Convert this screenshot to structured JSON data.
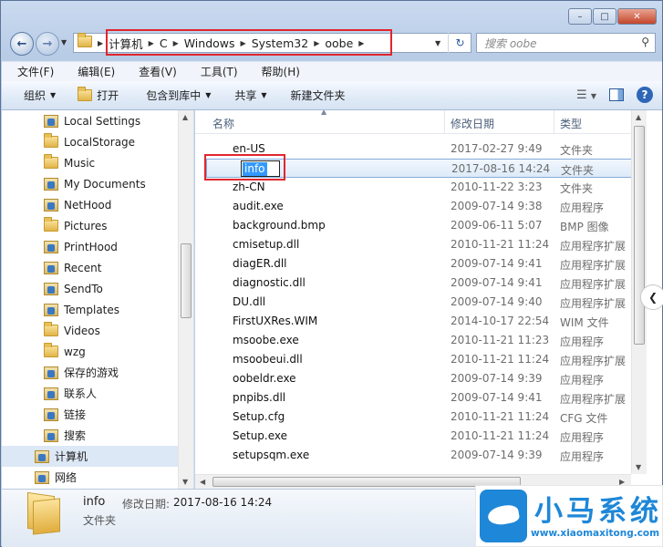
{
  "address": {
    "segments": [
      "计算机",
      "C",
      "Windows",
      "System32",
      "oobe"
    ]
  },
  "search": {
    "placeholder": "搜索 oobe"
  },
  "menu": [
    "文件(F)",
    "编辑(E)",
    "查看(V)",
    "工具(T)",
    "帮助(H)"
  ],
  "toolbar": {
    "organize": "组织",
    "open": "打开",
    "include": "包含到库中",
    "share": "共享",
    "new_folder": "新建文件夹"
  },
  "nav": [
    {
      "label": "Local Settings",
      "icon": "shortcut-folder-icon"
    },
    {
      "label": "LocalStorage",
      "icon": "folder-icon"
    },
    {
      "label": "Music",
      "icon": "folder-icon"
    },
    {
      "label": "My Documents",
      "icon": "shortcut-folder-icon"
    },
    {
      "label": "NetHood",
      "icon": "shortcut-folder-icon"
    },
    {
      "label": "Pictures",
      "icon": "folder-icon"
    },
    {
      "label": "PrintHood",
      "icon": "shortcut-folder-icon"
    },
    {
      "label": "Recent",
      "icon": "shortcut-folder-icon"
    },
    {
      "label": "SendTo",
      "icon": "shortcut-folder-icon"
    },
    {
      "label": "Templates",
      "icon": "shortcut-folder-icon"
    },
    {
      "label": "Videos",
      "icon": "folder-icon"
    },
    {
      "label": "wzg",
      "icon": "folder-icon"
    },
    {
      "label": "保存的游戏",
      "icon": "saved-games-icon"
    },
    {
      "label": "联系人",
      "icon": "contacts-icon"
    },
    {
      "label": "链接",
      "icon": "links-icon"
    },
    {
      "label": "搜索",
      "icon": "searches-icon"
    },
    {
      "label": "计算机",
      "icon": "computer-icon"
    },
    {
      "label": "网络",
      "icon": "network-icon"
    }
  ],
  "columns": {
    "name": "名称",
    "date": "修改日期",
    "type": "类型"
  },
  "files": [
    {
      "name": "en-US",
      "date": "2017-02-27 9:49",
      "type": "文件夹",
      "icon": "folder"
    },
    {
      "name": "info",
      "date": "2017-08-16 14:24",
      "type": "文件夹",
      "icon": "folder"
    },
    {
      "name": "zh-CN",
      "date": "2010-11-22 3:23",
      "type": "文件夹",
      "icon": "folder"
    },
    {
      "name": "audit.exe",
      "date": "2009-07-14 9:38",
      "type": "应用程序",
      "icon": "exe"
    },
    {
      "name": "background.bmp",
      "date": "2009-06-11 5:07",
      "type": "BMP 图像",
      "icon": "bmp"
    },
    {
      "name": "cmisetup.dll",
      "date": "2010-11-21 11:24",
      "type": "应用程序扩展",
      "icon": "dll"
    },
    {
      "name": "diagER.dll",
      "date": "2009-07-14 9:41",
      "type": "应用程序扩展",
      "icon": "dll"
    },
    {
      "name": "diagnostic.dll",
      "date": "2009-07-14 9:41",
      "type": "应用程序扩展",
      "icon": "dll"
    },
    {
      "name": "DU.dll",
      "date": "2009-07-14 9:40",
      "type": "应用程序扩展",
      "icon": "dll"
    },
    {
      "name": "FirstUXRes.WIM",
      "date": "2014-10-17 22:54",
      "type": "WIM 文件",
      "icon": "file"
    },
    {
      "name": "msoobe.exe",
      "date": "2010-11-21 11:23",
      "type": "应用程序",
      "icon": "exe"
    },
    {
      "name": "msoobeui.dll",
      "date": "2010-11-21 11:24",
      "type": "应用程序扩展",
      "icon": "dll"
    },
    {
      "name": "oobeldr.exe",
      "date": "2009-07-14 9:39",
      "type": "应用程序",
      "icon": "exe"
    },
    {
      "name": "pnpibs.dll",
      "date": "2009-07-14 9:41",
      "type": "应用程序扩展",
      "icon": "dll"
    },
    {
      "name": "Setup.cfg",
      "date": "2010-11-21 11:24",
      "type": "CFG 文件",
      "icon": "cfg"
    },
    {
      "name": "Setup.exe",
      "date": "2010-11-21 11:24",
      "type": "应用程序",
      "icon": "setup"
    },
    {
      "name": "setupsqm.exe",
      "date": "2009-07-14 9:39",
      "type": "应用程序",
      "icon": "exe"
    }
  ],
  "rename_value": "info",
  "details": {
    "name": "info",
    "date_label": "修改日期:",
    "date": "2017-08-16 14:24",
    "type": "文件夹"
  },
  "watermark": {
    "text": "小马系统",
    "url": "www.xiaomaxitong.com"
  }
}
